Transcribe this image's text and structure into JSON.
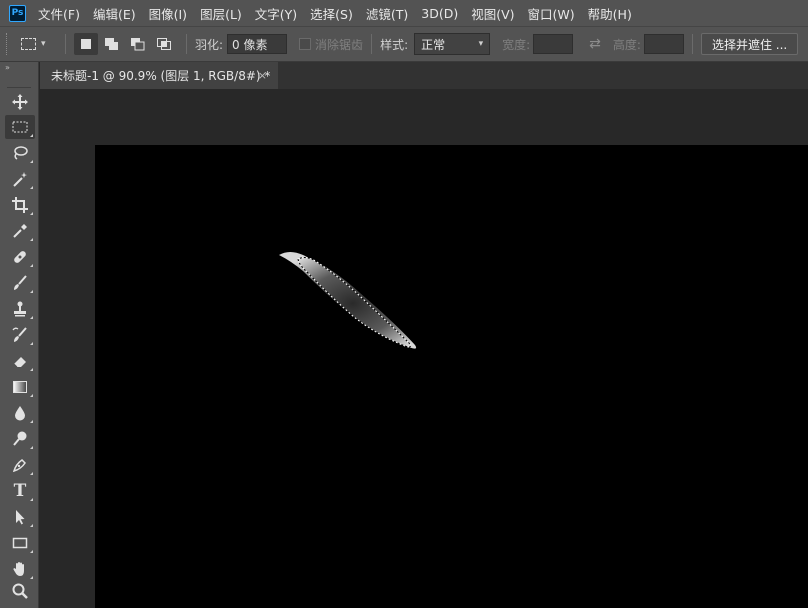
{
  "app": {
    "logo_text": "Ps",
    "menu": [
      "文件(F)",
      "编辑(E)",
      "图像(I)",
      "图层(L)",
      "文字(Y)",
      "选择(S)",
      "滤镜(T)",
      "3D(D)",
      "视图(V)",
      "窗口(W)",
      "帮助(H)"
    ]
  },
  "options_bar": {
    "feather_label": "羽化:",
    "feather_value": "0 像素",
    "antialias_label": "消除锯齿",
    "style_label": "样式:",
    "style_value": "正常",
    "width_label": "宽度:",
    "height_label": "高度:",
    "select_mask_button": "选择并遮住 ..."
  },
  "toolbar": {
    "collapse_glyph": "»",
    "tools": [
      {
        "name": "move-tool",
        "icon": "move-icon",
        "active": false
      },
      {
        "name": "rectangular-marquee-tool",
        "icon": "marquee-icon",
        "active": true
      },
      {
        "name": "lasso-tool",
        "icon": "lasso-icon",
        "active": false
      },
      {
        "name": "magic-wand-tool",
        "icon": "magic-wand-icon",
        "active": false
      },
      {
        "name": "crop-tool",
        "icon": "crop-icon",
        "active": false
      },
      {
        "name": "eyedropper-tool",
        "icon": "eyedropper-icon",
        "active": false
      },
      {
        "name": "healing-brush-tool",
        "icon": "bandage-icon",
        "active": false
      },
      {
        "name": "brush-tool",
        "icon": "brush-icon",
        "active": false
      },
      {
        "name": "clone-stamp-tool",
        "icon": "stamp-icon",
        "active": false
      },
      {
        "name": "history-brush-tool",
        "icon": "history-brush-icon",
        "active": false
      },
      {
        "name": "eraser-tool",
        "icon": "eraser-icon",
        "active": false
      },
      {
        "name": "gradient-tool",
        "icon": "gradient-icon",
        "active": false
      },
      {
        "name": "blur-tool",
        "icon": "drop-icon",
        "active": false
      },
      {
        "name": "dodge-tool",
        "icon": "dodge-icon",
        "active": false
      },
      {
        "name": "pen-tool",
        "icon": "pen-icon",
        "active": false
      },
      {
        "name": "type-tool",
        "icon": "type-icon",
        "active": false
      },
      {
        "name": "path-selection-tool",
        "icon": "arrow-icon",
        "active": false
      },
      {
        "name": "rectangle-tool",
        "icon": "rectangle-icon",
        "active": false
      },
      {
        "name": "hand-tool",
        "icon": "hand-icon",
        "active": false
      },
      {
        "name": "zoom-tool",
        "icon": "zoom-icon",
        "active": false
      }
    ],
    "type_glyph": "T"
  },
  "document": {
    "tab_title": "未标题-1 @ 90.9% (图层 1, RGB/8#) *",
    "close_glyph": "×"
  },
  "colors": {
    "chrome": "#535353",
    "workspace": "#282828",
    "canvas": "#000000",
    "accent": "#31a8ff"
  }
}
